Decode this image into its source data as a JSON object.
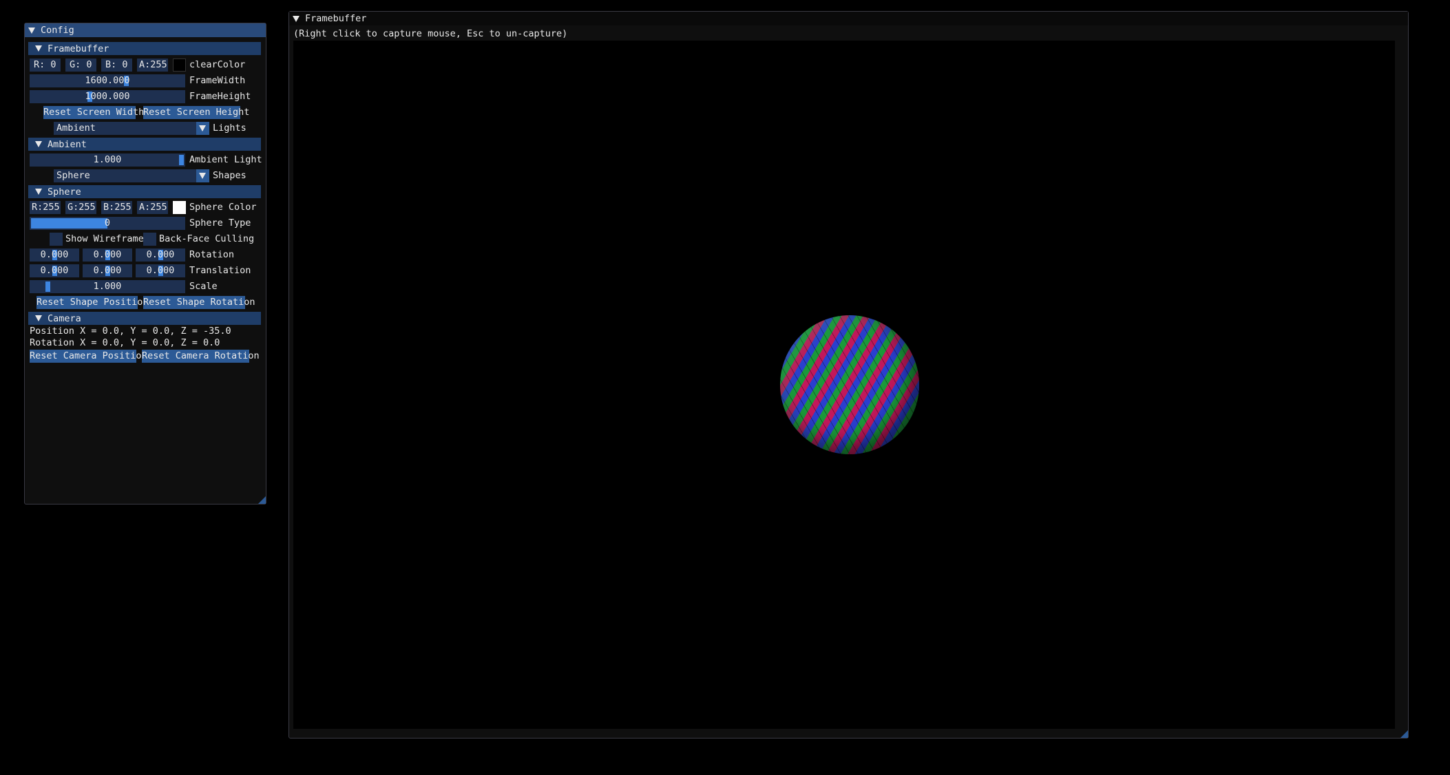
{
  "config_window": {
    "title": "Config",
    "framebuffer_section": {
      "title": "Framebuffer",
      "clear_color": {
        "r": "R:  0",
        "g": "G:  0",
        "b": "B:  0",
        "a": "A:255",
        "label": "clearColor",
        "swatch": "#000000"
      },
      "frame_width": {
        "value": "1600.000",
        "label": "FrameWidth"
      },
      "frame_height": {
        "value": "1000.000",
        "label": "FrameHeight"
      },
      "reset_width": "Reset Screen Width",
      "reset_height": "Reset Screen Height",
      "lights_combo": {
        "value": "Ambient",
        "label": "Lights"
      }
    },
    "ambient_section": {
      "title": "Ambient",
      "ambient_light": {
        "value": "1.000",
        "label": "Ambient Light"
      },
      "shapes_combo": {
        "value": "Sphere",
        "label": "Shapes"
      }
    },
    "sphere_section": {
      "title": "Sphere",
      "color": {
        "r": "R:255",
        "g": "G:255",
        "b": "B:255",
        "a": "A:255",
        "label": "Sphere Color",
        "swatch": "#ffffff"
      },
      "sphere_type": {
        "value": "0",
        "label": "Sphere Type"
      },
      "show_wireframe": "Show Wireframe",
      "back_face_culling": "Back-Face Culling",
      "rotation": {
        "x": "0.000",
        "y": "0.000",
        "z": "0.000",
        "label": "Rotation"
      },
      "translation": {
        "x": "0.000",
        "y": "0.000",
        "z": "0.000",
        "label": "Translation"
      },
      "scale": {
        "value": "1.000",
        "label": "Scale"
      },
      "reset_position": "Reset Shape Position",
      "reset_rotation": "Reset Shape Rotation"
    },
    "camera_section": {
      "title": "Camera",
      "position": "Position X = 0.0, Y = 0.0, Z = -35.0",
      "rotation": "Rotation X = 0.0, Y = 0.0, Z = 0.0",
      "reset_position": "Reset Camera Position",
      "reset_rotation": "Reset Camera Rotation"
    }
  },
  "framebuffer_window": {
    "title": "Framebuffer",
    "hint": "(Right click to capture mouse, Esc to un-capture)"
  },
  "colors": {
    "title_bar": "#294a7a",
    "header": "#1f3d68",
    "frame_bg": "#1e3050",
    "button": "#2c5a96",
    "slider_grab": "#3d85e0"
  }
}
